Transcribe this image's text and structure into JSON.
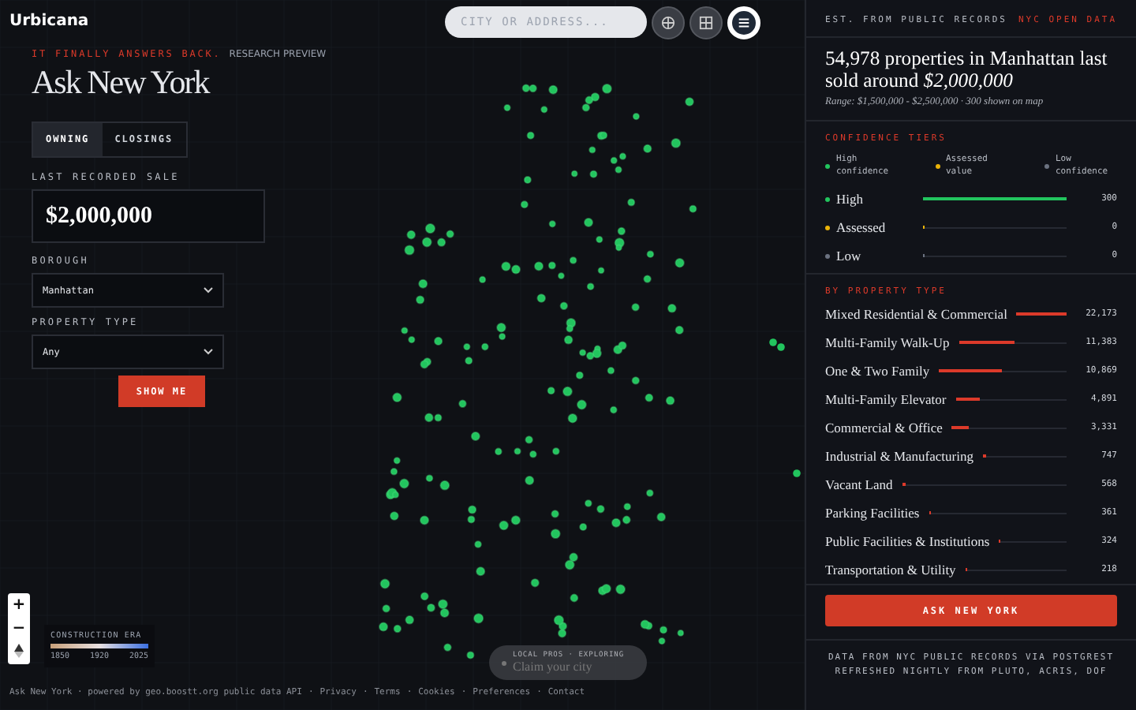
{
  "brand": "Urbicana",
  "search": {
    "placeholder": "CITY OR ADDRESS..."
  },
  "map_buttons": [
    {
      "kind": "globe",
      "selected": false
    },
    {
      "kind": "grid",
      "selected": false
    },
    {
      "kind": "menu",
      "selected": true
    }
  ],
  "query": {
    "eyebrow": "IT FINALLY ANSWERS BACK.",
    "badge": "RESEARCH PREVIEW",
    "title": "Ask New York",
    "tabs": [
      {
        "label": "OWNING",
        "selected": true
      },
      {
        "label": "CLOSINGS",
        "selected": false
      }
    ],
    "sale_label": "LAST RECORDED SALE",
    "sale_value": "$2,000,000",
    "borough_label": "BOROUGH",
    "borough": "Manhattan",
    "type_label": "PROPERTY TYPE",
    "type": "Any",
    "submit": "SHOW ME"
  },
  "zoom_controls": [
    "+",
    "−"
  ],
  "legend": {
    "title": "CONSTRUCTION ERA",
    "ticks": [
      "1850",
      "1920",
      "2025"
    ]
  },
  "claim": {
    "eyebrow": "LOCAL PROS · EXPLORING",
    "label": "Claim your city"
  },
  "footer": {
    "text": "Ask New York · powered by geo.boostt.org public data API",
    "separator": "·",
    "links": [
      "Privacy",
      "Terms",
      "Cookies",
      "Preferences",
      "Contact"
    ]
  },
  "results": {
    "source": "EST. FROM PUBLIC RECORDS",
    "tag": "NYC OPEN DATA",
    "headline": "54,978 properties in Manhattan last sold around *$2,000,000*",
    "range": "Range: $1,500,000 - $2,500,000 · 300 shown on map",
    "confidence": {
      "title": "CONFIDENCE TIERS",
      "legend": [
        {
          "label": "High confidence",
          "color": "#22c55e"
        },
        {
          "label": "Assessed value",
          "color": "#eab308"
        },
        {
          "label": "Low confidence",
          "color": "#6b7280"
        }
      ],
      "tiers": [
        {
          "label": "High",
          "color": "#22c55e",
          "level": 1,
          "count": "300"
        },
        {
          "label": "Assessed",
          "color": "#eab308",
          "level": 0,
          "count": "0"
        },
        {
          "label": "Low",
          "color": "#6b7280",
          "level": 0,
          "count": "0"
        }
      ]
    },
    "property_types": {
      "title": "BY PROPERTY TYPE",
      "rows": [
        {
          "label": "Mixed Residential & Commercial",
          "level": 1,
          "count": "22,173"
        },
        {
          "label": "Multi-Family Walk-Up",
          "level": 0.51,
          "count": "11,383"
        },
        {
          "label": "One & Two Family",
          "level": 0.49,
          "count": "10,869"
        },
        {
          "label": "Multi-Family Elevator",
          "level": 0.22,
          "count": "4,891"
        },
        {
          "label": "Commercial & Office",
          "level": 0.15,
          "count": "3,331"
        },
        {
          "label": "Industrial & Manufacturing",
          "level": 0.034,
          "count": "747"
        },
        {
          "label": "Vacant Land",
          "level": 0.026,
          "count": "568"
        },
        {
          "label": "Parking Facilities",
          "level": 0.016,
          "count": "361"
        },
        {
          "label": "Public Facilities & Institutions",
          "level": 0.015,
          "count": "324"
        },
        {
          "label": "Transportation & Utility",
          "level": 0.01,
          "count": "218"
        }
      ]
    },
    "cta": "ASK NEW YORK",
    "note": [
      "DATA FROM NYC PUBLIC RECORDS VIA POSTGREST",
      "REFRESHED NIGHTLY FROM PLUTO, ACRIS, DOF"
    ]
  }
}
